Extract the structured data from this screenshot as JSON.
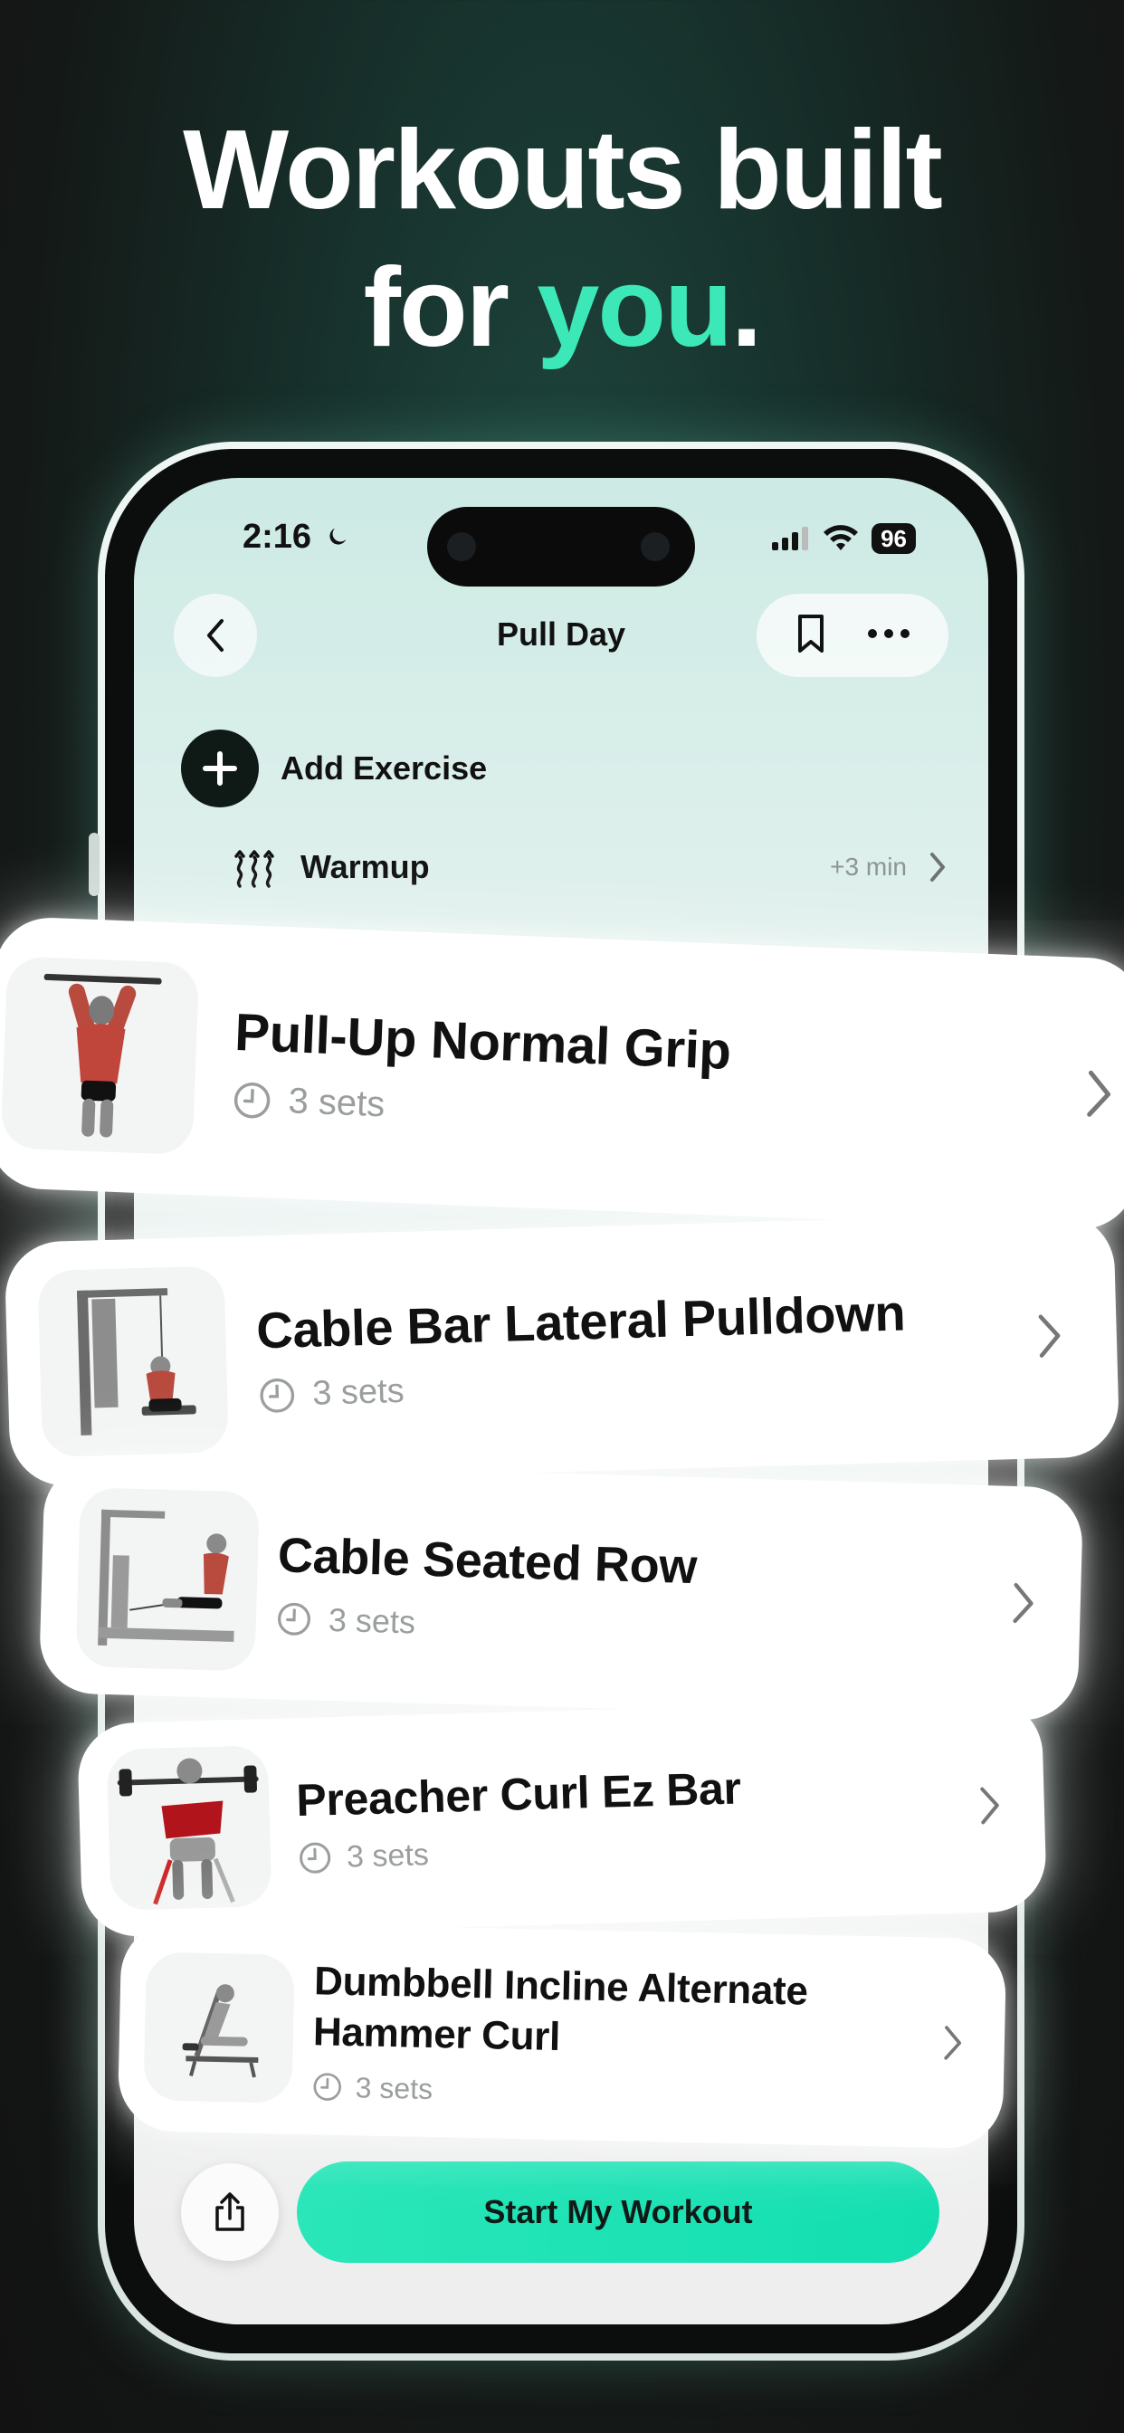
{
  "headline": {
    "line1": "Workouts built",
    "line2_prefix": "for ",
    "line2_accent": "you",
    "line2_suffix": "."
  },
  "status_bar": {
    "time": "2:16",
    "battery": "96"
  },
  "nav": {
    "title": "Pull Day",
    "back_icon": "chevron-left-icon",
    "bookmark_icon": "bookmark-icon",
    "more_icon": "ellipsis-icon"
  },
  "add_exercise": {
    "label": "Add Exercise"
  },
  "warmup": {
    "label": "Warmup",
    "time": "+3 min"
  },
  "exercises": [
    {
      "name": "Pull-Up Normal Grip",
      "sets": "3 sets"
    },
    {
      "name": "Cable Bar Lateral Pulldown",
      "sets": "3 sets"
    },
    {
      "name": "Cable Seated Row",
      "sets": "3 sets"
    },
    {
      "name": "Preacher Curl Ez Bar",
      "sets": "3 sets"
    },
    {
      "name_line1": "Dumbbell Incline Alternate",
      "name_line2": "Hammer Curl",
      "sets": "3 sets"
    }
  ],
  "bottom": {
    "start_label": "Start My Workout",
    "share_icon": "share-icon"
  },
  "colors": {
    "accent": "#3de8b8",
    "button": "#1fe2b4",
    "dark": "#0f1a17"
  }
}
